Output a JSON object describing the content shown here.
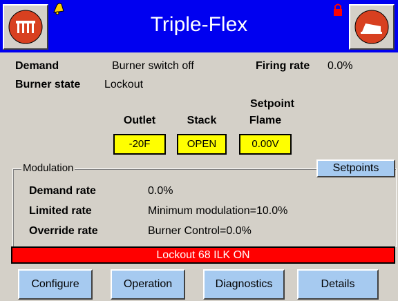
{
  "header": {
    "title": "Triple-Flex"
  },
  "status": {
    "demand_label": "Demand",
    "demand_value": "Burner switch off",
    "firing_rate_label": "Firing rate",
    "firing_rate_value": "0.0%",
    "burner_state_label": "Burner state",
    "burner_state_value": "Lockout"
  },
  "readouts": {
    "outlet": {
      "label": "Outlet",
      "value": "-20F"
    },
    "stack": {
      "label": "Stack",
      "value": "OPEN"
    },
    "flame": {
      "label_line1": "Setpoint",
      "label_line2": "Flame",
      "value": "0.00V"
    }
  },
  "modulation": {
    "group_label": "Modulation",
    "setpoints_button": "Setpoints",
    "rows": [
      {
        "label": "Demand rate",
        "value": "0.0%"
      },
      {
        "label": "Limited rate",
        "value": "Minimum modulation=10.0%"
      },
      {
        "label": "Override rate",
        "value": "Burner Control=0.0%"
      }
    ]
  },
  "alarm_bar": {
    "text": "Lockout 68  ILK ON",
    "color": "#ff0000"
  },
  "nav": {
    "configure": "Configure",
    "operation": "Operation",
    "diagnostics": "Diagnostics",
    "details": "Details"
  },
  "colors": {
    "header_bg": "#0000f0",
    "button_bg": "#a6caf0",
    "readout_bg": "#ffff00",
    "panel_bg": "#d4d0c8",
    "icon_red": "#d84020"
  },
  "icons": [
    "home-icon",
    "bell-icon",
    "lock-icon",
    "logout-icon"
  ]
}
